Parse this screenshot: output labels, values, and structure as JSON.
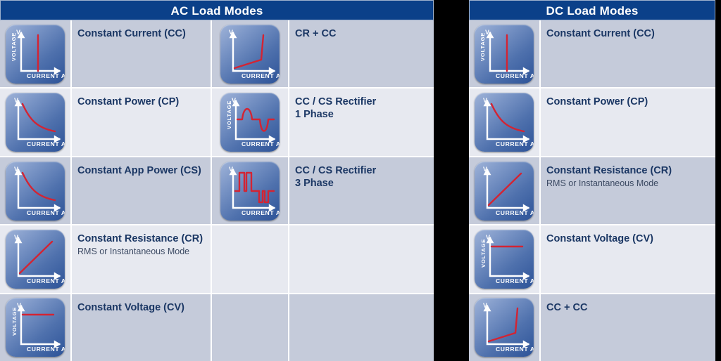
{
  "tables": [
    {
      "id": "ac-table",
      "title": "AC Load Modes",
      "rows": [
        {
          "shade": "dark",
          "left": {
            "icon": "constant-current-graph-icon",
            "main": "Constant Current (CC)",
            "sub": ""
          },
          "right": {
            "icon": "cr-plus-cc-graph-icon",
            "main": "CR + CC",
            "sub": ""
          }
        },
        {
          "shade": "light",
          "left": {
            "icon": "constant-power-graph-icon",
            "main": "Constant Power (CP)",
            "sub": ""
          },
          "right": {
            "icon": "rectifier-1-phase-graph-icon",
            "main": "CC / CS Rectifier\n1 Phase",
            "sub": ""
          }
        },
        {
          "shade": "dark",
          "left": {
            "icon": "constant-app-power-graph-icon",
            "main": "Constant App Power (CS)",
            "sub": ""
          },
          "right": {
            "icon": "rectifier-3-phase-graph-icon",
            "main": "CC / CS Rectifier\n3 Phase",
            "sub": ""
          }
        },
        {
          "shade": "light",
          "left": {
            "icon": "constant-resistance-graph-icon",
            "main": "Constant Resistance (CR)",
            "sub": "RMS or Instantaneous Mode"
          },
          "right": {
            "icon": "",
            "main": "",
            "sub": ""
          }
        },
        {
          "shade": "dark",
          "left": {
            "icon": "constant-voltage-graph-icon",
            "main": "Constant Voltage (CV)",
            "sub": ""
          },
          "right": {
            "icon": "",
            "main": "",
            "sub": ""
          }
        }
      ]
    },
    {
      "id": "dc-table",
      "title": "DC Load Modes",
      "rows": [
        {
          "shade": "dark",
          "left": {
            "icon": "constant-current-graph-icon",
            "main": "Constant Current (CC)",
            "sub": ""
          }
        },
        {
          "shade": "light",
          "left": {
            "icon": "constant-power-graph-icon",
            "main": "Constant Power (CP)",
            "sub": ""
          }
        },
        {
          "shade": "dark",
          "left": {
            "icon": "constant-resistance-graph-icon",
            "main": "Constant Resistance (CR)",
            "sub": "RMS or Instantaneous Mode"
          }
        },
        {
          "shade": "light",
          "left": {
            "icon": "constant-voltage-graph-icon",
            "main": "Constant Voltage (CV)",
            "sub": ""
          }
        },
        {
          "shade": "dark",
          "left": {
            "icon": "cc-plus-cc-graph-icon",
            "main": "CC + CC",
            "sub": ""
          }
        }
      ]
    }
  ],
  "axis_labels": {
    "x": "CURRENT  A",
    "y_short": "V",
    "y_long": "VOLTAGE"
  },
  "colors": {
    "header_blue": "#0b4089",
    "row_dark": "#c5cbda",
    "row_light": "#e7e9f0",
    "label_navy": "#1b3764",
    "curve_red": "#d32433",
    "page_background": "#000000"
  },
  "chart_data": [
    {
      "id": "constant-current-graph-icon",
      "type": "line",
      "xlabel": "CURRENT  A",
      "ylabel": "VOLTAGE",
      "description": "Vertical line at constant current"
    },
    {
      "id": "constant-power-graph-icon",
      "type": "line",
      "xlabel": "CURRENT  A",
      "ylabel": "V",
      "description": "Hyperbolic decaying curve, constant power"
    },
    {
      "id": "constant-app-power-graph-icon",
      "type": "line",
      "xlabel": "CURRENT  A",
      "ylabel": "V",
      "description": "Hyperbolic decaying curve, constant apparent power"
    },
    {
      "id": "constant-resistance-graph-icon",
      "type": "line",
      "xlabel": "CURRENT  A",
      "ylabel": "V",
      "description": "Straight rising line through origin, ohmic"
    },
    {
      "id": "constant-voltage-graph-icon",
      "type": "line",
      "xlabel": "CURRENT  A",
      "ylabel": "VOLTAGE",
      "description": "Horizontal line at constant voltage"
    },
    {
      "id": "cr-plus-cc-graph-icon",
      "type": "line",
      "xlabel": "CURRENT  A",
      "ylabel": "V",
      "description": "Shallow rising ramp then vertical rise"
    },
    {
      "id": "cc-plus-cc-graph-icon",
      "type": "line",
      "xlabel": "CURRENT  A",
      "ylabel": "V",
      "description": "Shallow rising ramp then vertical rise"
    },
    {
      "id": "rectifier-1-phase-graph-icon",
      "type": "line",
      "xlabel": "CURRENT  A",
      "ylabel": "VOLTAGE",
      "description": "Flat baseline, one positive pulse, flat, one negative pulse, flat"
    },
    {
      "id": "rectifier-3-phase-graph-icon",
      "type": "line",
      "xlabel": "CURRENT  A",
      "ylabel": "V",
      "description": "Two positive pulses then two negative pulses on baseline"
    }
  ]
}
